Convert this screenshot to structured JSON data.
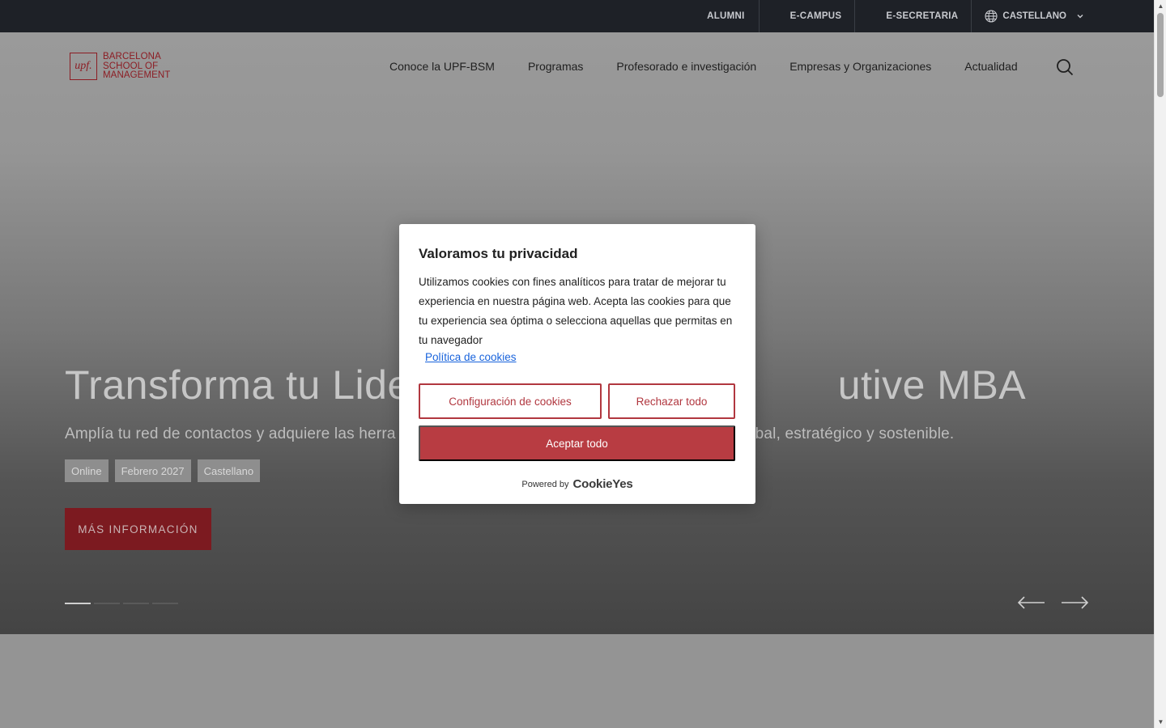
{
  "topbar": {
    "links": [
      "ALUMNI",
      "E-CAMPUS",
      "E-SECRETARIA"
    ],
    "language": "CASTELLANO"
  },
  "logo": {
    "mark": "upf.",
    "line1": "BARCELONA",
    "line2": "SCHOOL OF",
    "line3": "MANAGEMENT"
  },
  "nav": {
    "items": [
      "Conoce la UPF-BSM",
      "Programas",
      "Profesorado e investigación",
      "Empresas y Organizaciones",
      "Actualidad"
    ]
  },
  "hero": {
    "title": "Transforma tu Lide                                          utive MBA",
    "title_left": "Transforma tu Lide",
    "title_right": "utive MBA",
    "subtitle_left": "Amplía tu red de contactos y adquiere las herra",
    "subtitle_right": "bal, estratégico y sostenible.",
    "tags": [
      "Online",
      "Febrero 2027",
      "Castellano"
    ],
    "cta": "MÁS INFORMACIÓN",
    "slides_total": 4,
    "slide_active": 1
  },
  "cookie_modal": {
    "title": "Valoramos tu privacidad",
    "body": "Utilizamos cookies con fines analíticos para tratar de mejorar tu experiencia en nuestra página web. Acepta las cookies para que tu experiencia sea óptima o selecciona aquellas que permitas en tu navegador",
    "policy_link": "Política de cookies",
    "config_button": "Configuración de cookies",
    "reject_button": "Rechazar todo",
    "accept_button": "Aceptar todo",
    "powered_by": "Powered by",
    "powered_brand": "CookieYes"
  },
  "colors": {
    "brand_red": "#8c1d24",
    "accept_red": "#b83c42",
    "topbar": "#1e2127",
    "link_blue": "#1863dc"
  }
}
